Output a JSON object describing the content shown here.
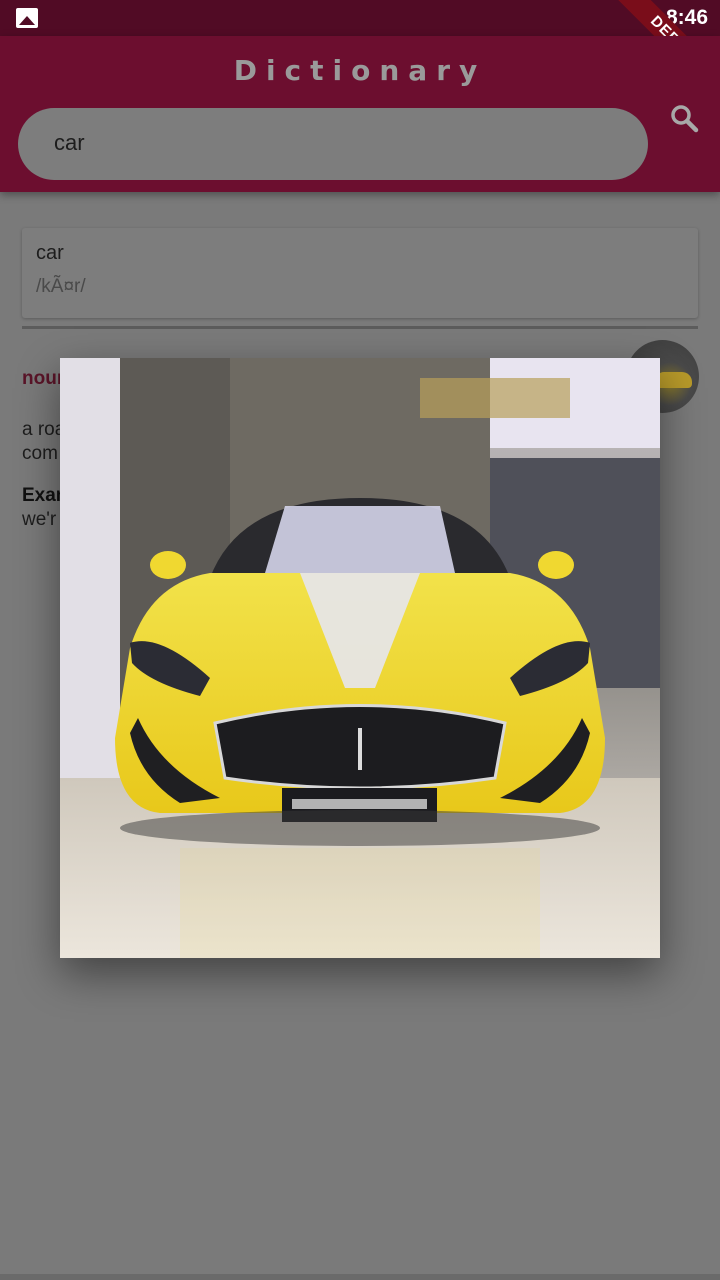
{
  "status_bar": {
    "time": "8:46",
    "debug_label": "DEBUG",
    "notification_icon": "image-icon"
  },
  "app_bar": {
    "title": "Dictionary"
  },
  "search": {
    "value": "car",
    "placeholder": "",
    "icon": "search-icon"
  },
  "result": {
    "word": "car",
    "phonetic": "/kÃ¤r/",
    "part_of_speech": "noun",
    "definition_visible": "a roa",
    "definition_visible_line2": "com",
    "example_label": "Exam",
    "example_text": "we'r"
  },
  "image_dialog": {
    "image": "yellow-sports-car-photo"
  },
  "colors": {
    "app_bar": "#6c0e2f",
    "status_bar": "#510b25",
    "accent": "#5a1428",
    "scrim": "#7a7a7a"
  }
}
